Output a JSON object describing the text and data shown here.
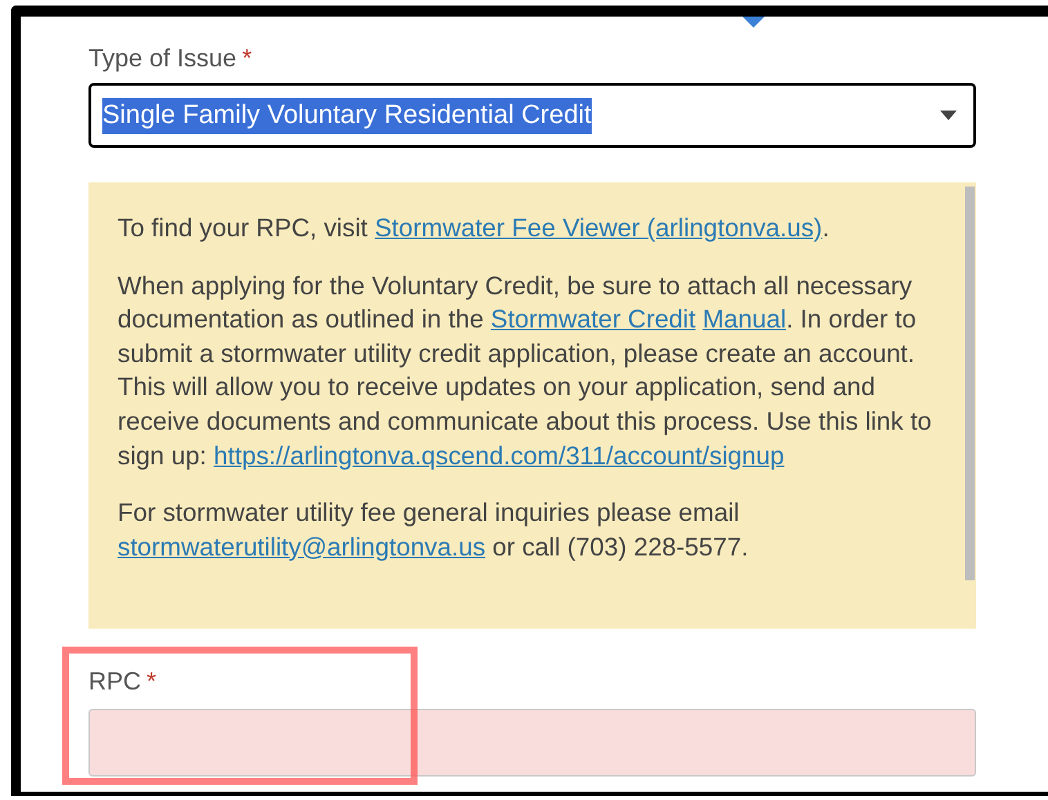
{
  "issue_type": {
    "label": "Type of Issue",
    "required_mark": "*",
    "value": "Single Family Voluntary Residential Credit",
    "text_highlighted": true
  },
  "info_box": {
    "paragraphs": [
      [
        {
          "kind": "text",
          "text": "To find your RPC, visit "
        },
        {
          "kind": "link",
          "text": "Stormwater Fee Viewer (arlingtonva.us)"
        },
        {
          "kind": "text",
          "text": "."
        }
      ],
      [
        {
          "kind": "text",
          "text": "When applying for the Voluntary Credit, be sure to attach all necessary documentation as outlined in the "
        },
        {
          "kind": "link",
          "text": "Stormwater Credit"
        },
        {
          "kind": "link",
          "text": "Manual"
        },
        {
          "kind": "text",
          "text": ". In order to submit a stormwater utility credit application, please create an account. This will allow you to receive updates on your application, send and receive documents and communicate about this process. Use this link to sign up: "
        },
        {
          "kind": "link",
          "text": "https://arlingtonva.qscend.com/311/account/signup"
        }
      ],
      [
        {
          "kind": "text",
          "text": "For stormwater utility fee general inquiries please email "
        },
        {
          "kind": "link",
          "text": "stormwaterutility@arlingtonva.us"
        },
        {
          "kind": "text",
          "text": " or call (703) 228-5577."
        }
      ]
    ]
  },
  "rpc": {
    "label": "RPC",
    "required_mark": "*",
    "invalid": true,
    "highlighted": true
  }
}
